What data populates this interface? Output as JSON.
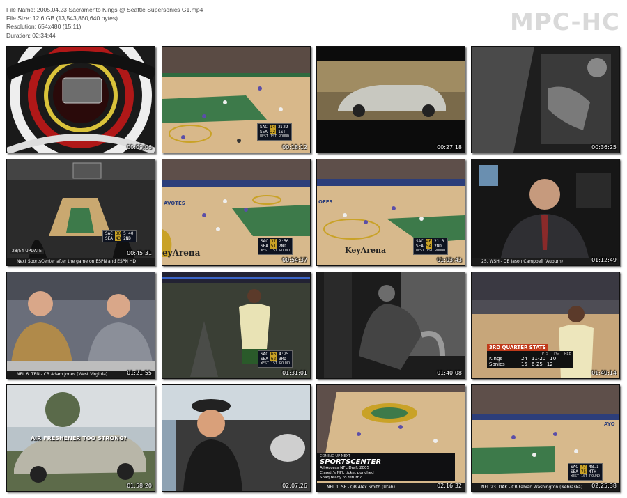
{
  "meta": {
    "file_name": "File Name: 2005.04.23 Sacramento Kings @ Seattle Supersonics G1.mp4",
    "file_size": "File Size: 12.6 GB (13,543,860,640 bytes)",
    "resolution": "Resolution: 654x480 (15:11)",
    "duration": "Duration: 02:34:44"
  },
  "brand": "MPC-HC",
  "thumbs": [
    {
      "time": "00:09:06"
    },
    {
      "time": "00:18:12",
      "score": {
        "brand": "ESPN",
        "t1": "SAC",
        "s1": "14",
        "t2": "SEA",
        "s2": "22",
        "clock": "2:22",
        "period": "1ST",
        "round": "WEST 1ST ROUND"
      }
    },
    {
      "time": "00:27:18"
    },
    {
      "time": "00:36:25"
    },
    {
      "time": "00:45:31",
      "ticker": "Next SportsCenter after the game on ESPN and ESPN HD",
      "top_ticker": "28/54 UPDATE",
      "score": {
        "t1": "SAC",
        "s1": "30",
        "t2": "SEA",
        "s2": "43",
        "clock": "5:40",
        "period": "2ND"
      }
    },
    {
      "time": "00:54:37",
      "score": {
        "t1": "SAC",
        "s1": "37",
        "t2": "SEA",
        "s2": "51",
        "clock": "2:56",
        "period": "2ND",
        "round": "WEST 1ST ROUND"
      },
      "court_text": "eyArena",
      "banner": "AVOTES"
    },
    {
      "time": "01:03:43",
      "score": {
        "t1": "SAC",
        "s1": "46",
        "t2": "SEA",
        "s2": "54",
        "clock": "21.3",
        "period": "2ND",
        "round": "WEST 1ST ROUND"
      },
      "court_text": "KeyArena",
      "banner": "OFFS"
    },
    {
      "time": "01:12:49",
      "ticker": "25. WSH - QB Jason Campbell (Auburn)"
    },
    {
      "time": "01:21:55",
      "ticker": "NFL  6. TEN - CB Adam Jones (West Virginia)"
    },
    {
      "time": "01:31:01",
      "score": {
        "t1": "SAC",
        "s1": "66",
        "t2": "SEA",
        "s2": "62",
        "clock": "4:25",
        "period": "3RD",
        "round": "WEST 1ST ROUND"
      }
    },
    {
      "time": "01:40:08"
    },
    {
      "time": "01:49:14",
      "stats": {
        "title": "3RD QUARTER STATS",
        "headers": [
          "PTS",
          "FG",
          "REB"
        ],
        "rows": [
          {
            "team": "Kings",
            "pts": "24",
            "fg": "11-20",
            "reb": "10"
          },
          {
            "team": "Sonics",
            "pts": "15",
            "fg": "6-25",
            "reb": "12"
          }
        ]
      }
    },
    {
      "time": "01:58:20",
      "caption": "AIR FRESHENER TOO STRONG?"
    },
    {
      "time": "02:07:26"
    },
    {
      "time": "02:16:32",
      "coming": "COMING UP NEXT",
      "sc": "SPORTSCENTER",
      "bullets": [
        "All-Access NFL Draft 2005",
        "Clarett's NFL ticket punched",
        "Shaq ready to return?"
      ],
      "ticker": "NFL  1. SF - QB Alex Smith (Utah)"
    },
    {
      "time": "02:25:38",
      "score": {
        "t1": "SAC",
        "s1": "77",
        "t2": "SEA",
        "s2": "75",
        "clock": "48.1",
        "period": "4TH",
        "round": "WEST 1ST ROUND"
      },
      "ticker": "NFL  23. OAK - CB Fabian Washington (Nebraska)",
      "banner": "AYO"
    }
  ]
}
